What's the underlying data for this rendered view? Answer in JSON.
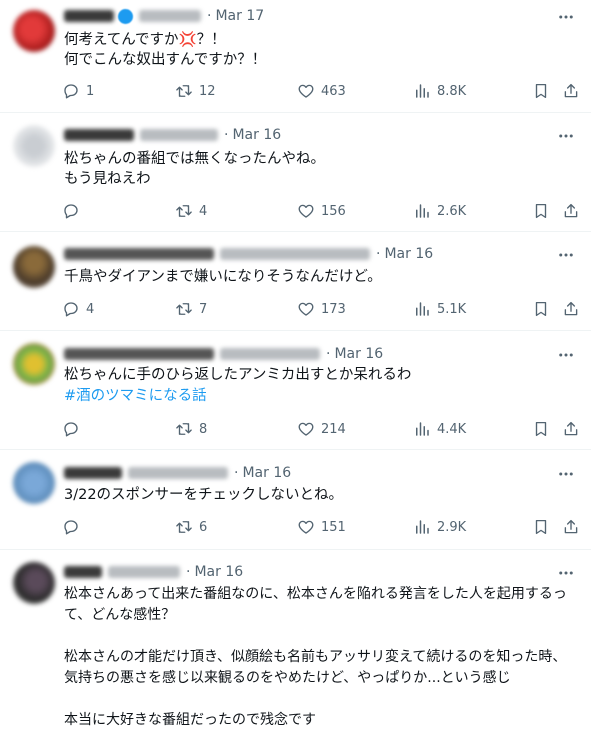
{
  "colors": {
    "text": "#0f1419",
    "muted": "#536471",
    "link": "#1d9bf0",
    "divider": "#eff3f4"
  },
  "icons": {
    "reply": "reply-icon",
    "retweet": "retweet-icon",
    "like": "like-icon",
    "views": "views-icon",
    "bookmark": "bookmark-icon",
    "share": "share-icon",
    "more": "more-icon"
  },
  "tweets": [
    {
      "date": "Mar 17",
      "text": "何考えてんですか💢？！\n何でこんな奴出すんですか？！",
      "hashtag": "",
      "replies": "1",
      "retweets": "12",
      "likes": "463",
      "views": "8.8K"
    },
    {
      "date": "Mar 16",
      "text": "松ちゃんの番組では無くなったんやね。\nもう見ねえわ",
      "hashtag": "",
      "replies": "",
      "retweets": "4",
      "likes": "156",
      "views": "2.6K"
    },
    {
      "date": "Mar 16",
      "text": "千鳥やダイアンまで嫌いになりそうなんだけど。",
      "hashtag": "",
      "replies": "4",
      "retweets": "7",
      "likes": "173",
      "views": "5.1K"
    },
    {
      "date": "Mar 16",
      "text": "松ちゃんに手のひら返したアンミカ出すとか呆れるわ",
      "hashtag": "#酒のツマミになる話",
      "replies": "",
      "retweets": "8",
      "likes": "214",
      "views": "4.4K"
    },
    {
      "date": "Mar 16",
      "text": "3/22のスポンサーをチェックしないとね。",
      "hashtag": "",
      "replies": "",
      "retweets": "6",
      "likes": "151",
      "views": "2.9K"
    },
    {
      "date": "Mar 16",
      "text": "松本さんあって出来た番組なのに、松本さんを陥れる発言をした人を起用するって、どんな感性？\n\n松本さんの才能だけ頂き、似顔絵も名前もアッサリ変えて続けるのを知った時、気持ちの悪さを感じ以来観るのをやめたけど、やっぱりか...という感じ\n\n本当に大好きな番組だったので残念です",
      "hashtag": "",
      "replies": "",
      "retweets": "",
      "likes": "",
      "views": ""
    }
  ]
}
